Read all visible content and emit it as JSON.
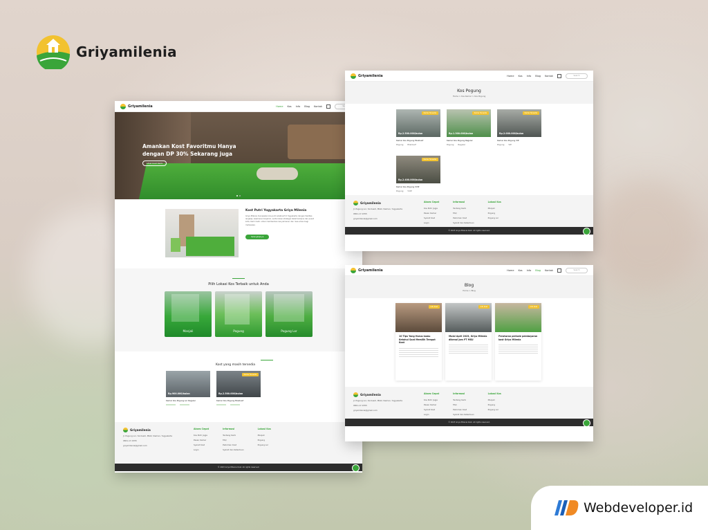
{
  "brand": {
    "name": "Griyamilenia",
    "logo_icon": "house-hill-logo-icon"
  },
  "nav": {
    "logo_text": "Griyamilenia",
    "items": [
      "Home",
      "Kos",
      "Info",
      "Blog",
      "Kontak"
    ],
    "search_placeholder": "Search"
  },
  "home": {
    "hero_title": "Amankan Kost Favoritmu Hanya dengan DP 30% Sekarang juga",
    "hero_button": "Lihat Kost Kami",
    "about_title": "Kost Putri Yogyakarta Griya Milenia",
    "about_text": "Griya Milenia merupakan kos putri eksklusif di Yogyakarta dengan fasilitas lengkap, keamanan terjamin, serta lokasi strategis dekat kampus dan pusat kota. Kami hadir untuk memberikan kenyamanan dan rasa aman bagi mahasiswi.",
    "about_button": "Selengkapnya",
    "locations_title": "Pilih Lokasi Kos Terbaik untuk Anda",
    "locations": [
      "Manjali",
      "Pogung",
      "Pogung Lor"
    ],
    "available_title": "Kost yang masih tersedia",
    "available": [
      {
        "price": "Rp.900.000/bulan",
        "name": "Kamar Kos Pogung Lor Reguler",
        "badge": ""
      },
      {
        "price": "Rp.2.500.000/bulan",
        "name": "Kamar Kos Pogung Eksklusif",
        "badge": "Kamar Tersedia"
      }
    ]
  },
  "kos_page": {
    "title": "Kos Pogung",
    "breadcrumb": "Home > Kos Kamar > Kos Pogung",
    "cards": [
      {
        "price": "Rp.2.500.000/bulan",
        "name": "Kamar Kos Pogung Eksklusif",
        "badge": "Kamar Tersedia",
        "loc": "Pogung",
        "type": "Eksklusif"
      },
      {
        "price": "Rp.1.300.000/bulan",
        "name": "Kamar Kos Pogung Reguler",
        "badge": "Kamar Tersedia",
        "loc": "Pogung",
        "type": "Reguler"
      },
      {
        "price": "Rp.2.000.000/bulan",
        "name": "Kamar Kos Pogung VIP",
        "badge": "Kamar Tersedia",
        "loc": "Pogung",
        "type": "VIP"
      },
      {
        "price": "Rp.2.400.000/bulan",
        "name": "Kamar Kos Pogung VVIP",
        "badge": "Kamar Tersedia",
        "loc": "Pogung",
        "type": "VVIP"
      }
    ]
  },
  "blog_page": {
    "title": "Blog",
    "breadcrumb": "Home > Blog",
    "posts": [
      {
        "title": "10 Tips Yang Harus kamu Ketahui Saat Memilih Tempat Kost",
        "badge": "Info Kost"
      },
      {
        "title": "Mulai April 2023, Griya Milenia dikenai Jam PT MSU",
        "badge": "Info Kost"
      },
      {
        "title": "Peraturan periode pembayaran kost Griya Milenia",
        "badge": "Info Kost"
      }
    ]
  },
  "footer": {
    "logo_text": "Griyamilenia",
    "address": "Jl. Pogung Lor, Sinduadi, Mlati, Sleman, Yogyakarta",
    "phone": "0821-17-1555",
    "email": "griyamilenia@gmail.com",
    "cols": [
      {
        "title": "Akses Cepat",
        "items": [
          "Kos Putri Jogja",
          "Pesan Kamar",
          "Syarat Kost",
          "Login"
        ]
      },
      {
        "title": "Informasi",
        "items": [
          "Tentang Kami",
          "FAQ",
          "Pedoman Kost",
          "Syarat dan Ketentuan"
        ]
      },
      {
        "title": "Lokasi Kos",
        "items": [
          "Manjali",
          "Pogung",
          "Pogung Lor"
        ]
      }
    ],
    "copyright": "© 2023 Griya Milenia Kost. All rights reserved."
  },
  "watermark": {
    "name": "Webdeveloper.id"
  },
  "colors": {
    "accent": "#3aa53a",
    "badge": "#f2c230",
    "dark": "#2d2d2d"
  }
}
